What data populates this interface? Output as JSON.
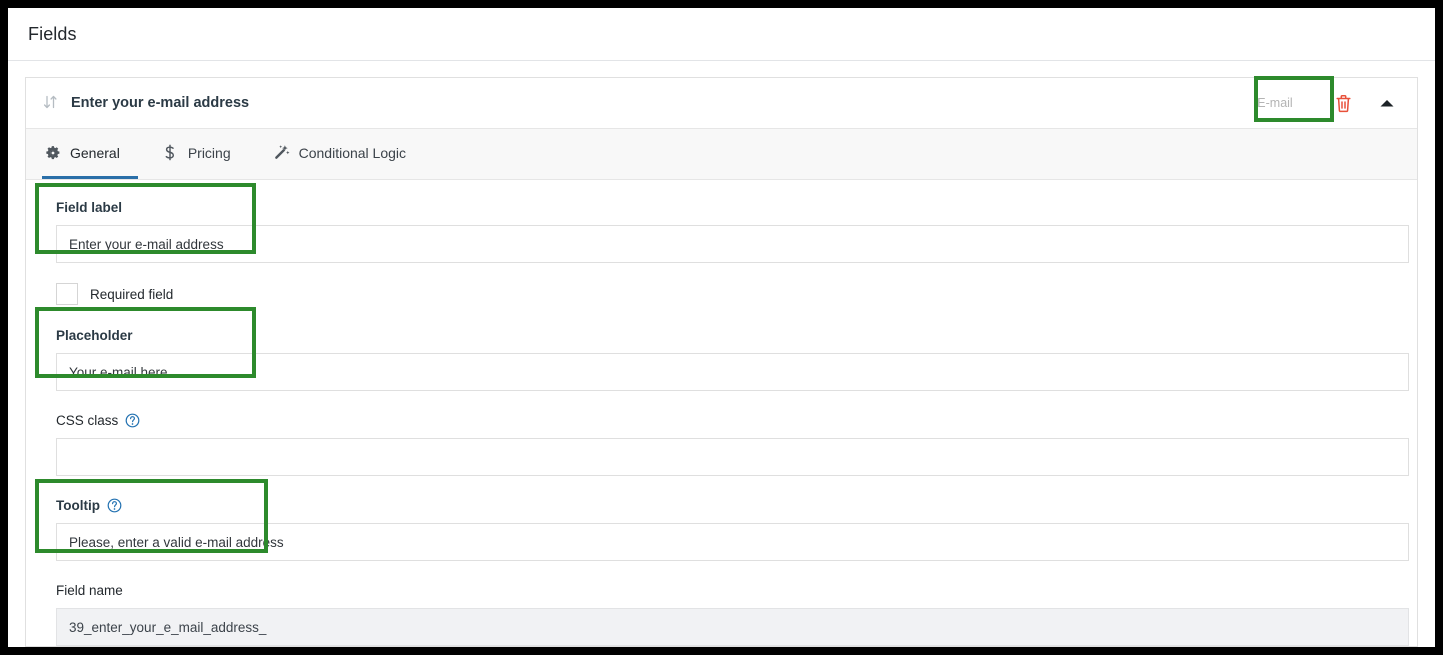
{
  "page": {
    "title": "Fields"
  },
  "field_panel": {
    "header": {
      "sort_handle_icon": "sort-updown-icon",
      "title": "Enter your e-mail address",
      "type_badge": "E-mail",
      "delete_icon": "trash-icon",
      "collapse_icon": "triangle-up-icon"
    },
    "tabs": [
      {
        "label": "General",
        "icon": "gear-icon",
        "active": true
      },
      {
        "label": "Pricing",
        "icon": "dollar-icon",
        "active": false
      },
      {
        "label": "Conditional Logic",
        "icon": "magic-wand-icon",
        "active": false
      }
    ],
    "fields": {
      "field_label": {
        "label": "Field label",
        "value": "Enter your e-mail address"
      },
      "required": {
        "label": "Required field",
        "checked": false
      },
      "placeholder": {
        "label": "Placeholder",
        "value": "Your e-mail here..."
      },
      "css_class": {
        "label": "CSS class",
        "help_icon": "question-circle-icon",
        "value": ""
      },
      "tooltip": {
        "label": "Tooltip",
        "help_icon": "question-circle-icon",
        "value": "Please, enter a valid e-mail address"
      },
      "field_name": {
        "label": "Field name",
        "value": "39_enter_your_e_mail_address_",
        "readonly": true
      }
    }
  },
  "annotations": {
    "highlight_color": "#2d8a2c",
    "boxes": [
      {
        "name": "type-badge-highlight"
      },
      {
        "name": "field-label-highlight"
      },
      {
        "name": "placeholder-highlight"
      },
      {
        "name": "tooltip-highlight"
      }
    ]
  },
  "colors": {
    "accent_blue": "#2a6fa8",
    "trash_red": "#e04a4a",
    "help_blue": "#2271b1"
  }
}
